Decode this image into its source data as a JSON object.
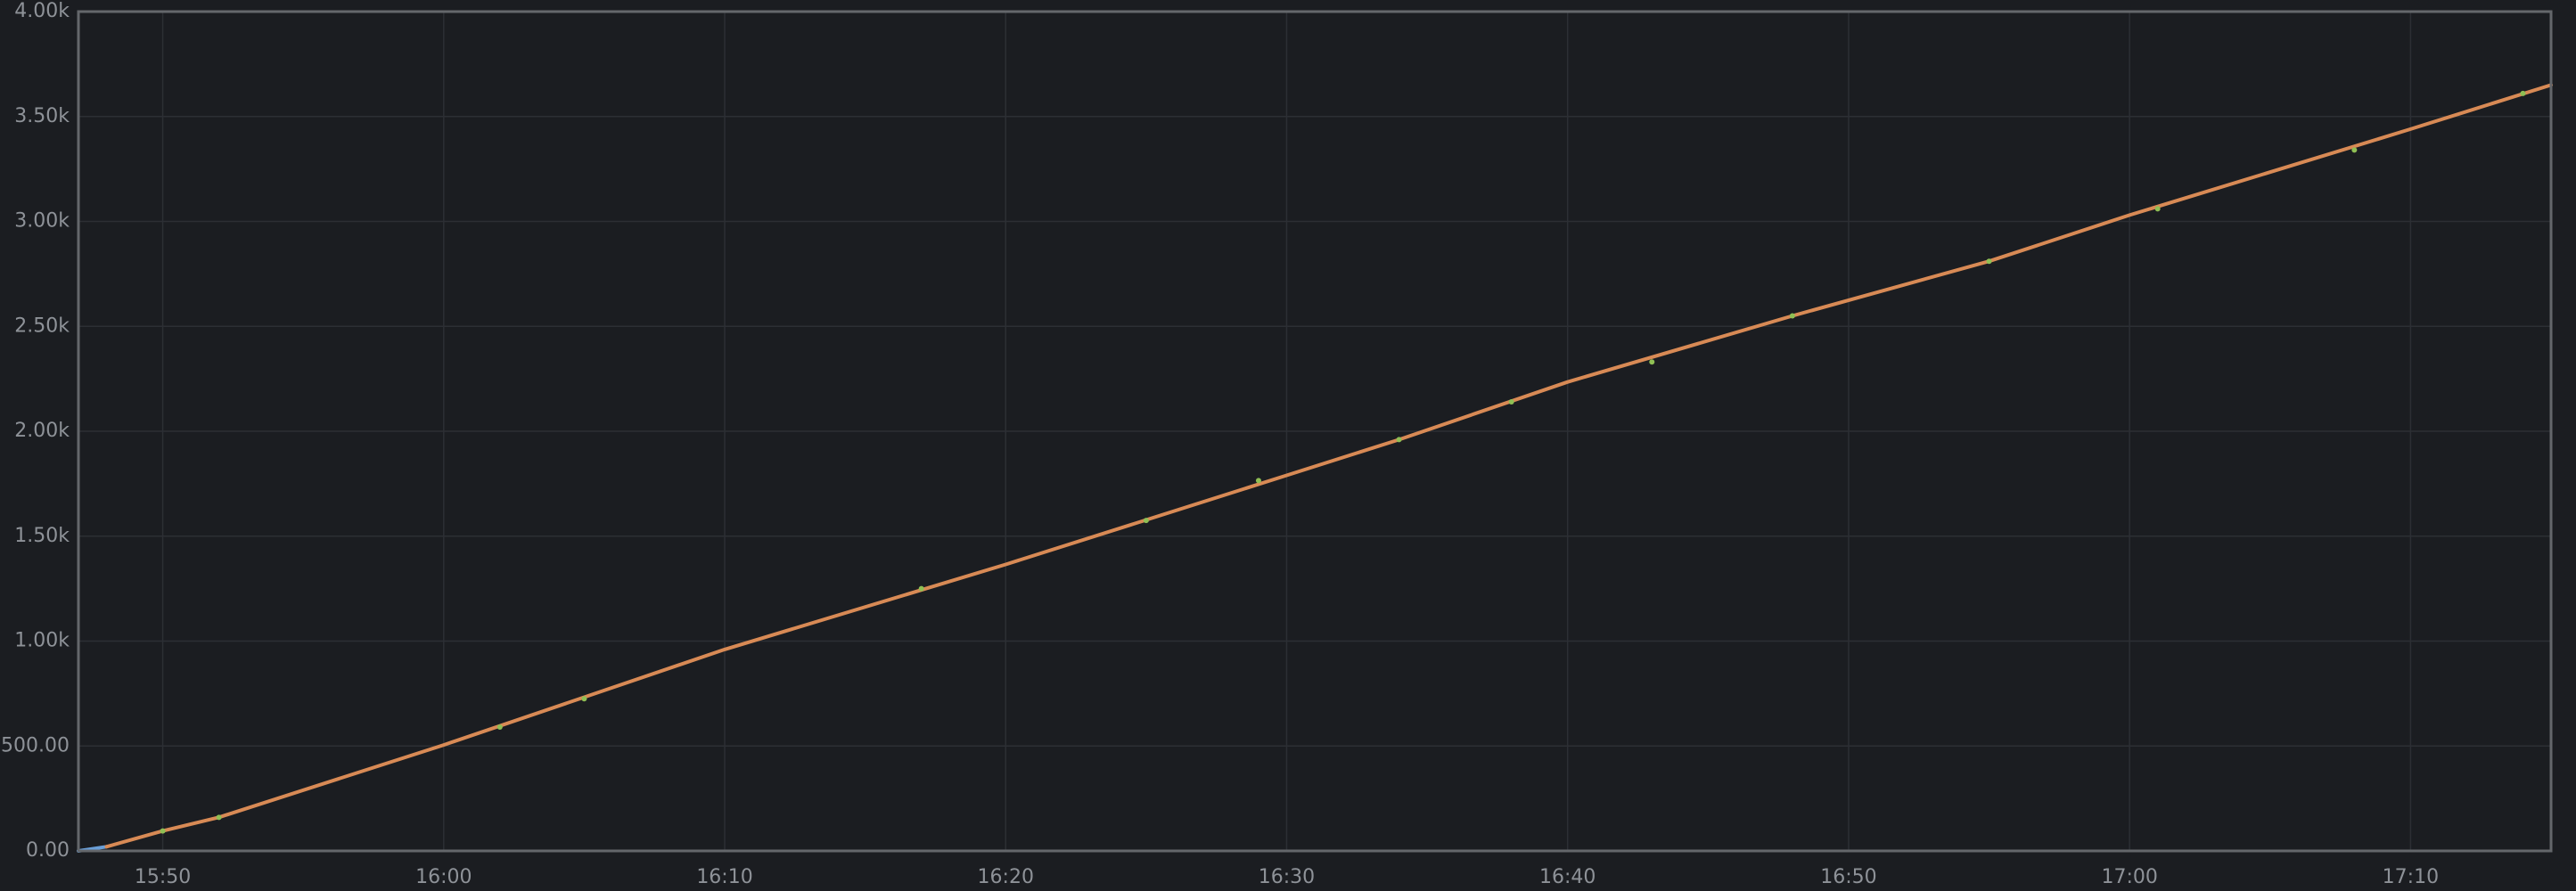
{
  "chart_data": {
    "type": "line",
    "title": "",
    "xlabel": "",
    "ylabel": "",
    "x_ticks": [
      "15:50",
      "16:00",
      "16:10",
      "16:20",
      "16:30",
      "16:40",
      "16:50",
      "17:00",
      "17:10"
    ],
    "y_ticks": [
      "0.00",
      "500.00",
      "1.00k",
      "1.50k",
      "2.00k",
      "2.50k",
      "3.00k",
      "3.50k",
      "4.00k"
    ],
    "xlim": [
      "15:47",
      "17:15"
    ],
    "ylim": [
      0,
      4000
    ],
    "grid": true,
    "legend": "none",
    "series": [
      {
        "color": "#6a9fd8",
        "x": [
          "15:47",
          "15:48"
        ],
        "y": [
          0,
          20
        ]
      },
      {
        "color": "#d88a55",
        "x": [
          "15:48",
          "15:50",
          "15:52",
          "16:00",
          "16:10",
          "16:20",
          "16:30",
          "16:34",
          "16:40",
          "16:48",
          "16:55",
          "17:00",
          "17:10",
          "17:15"
        ],
        "y": [
          20,
          95,
          160,
          505,
          960,
          1365,
          1790,
          1960,
          2235,
          2550,
          2810,
          3030,
          3440,
          3650
        ]
      }
    ],
    "markers": {
      "color": "#8fbf54",
      "x": [
        "15:50",
        "15:52",
        "16:02",
        "16:05",
        "16:17",
        "16:25",
        "16:29",
        "16:34",
        "16:38",
        "16:43",
        "16:48",
        "16:55",
        "17:01",
        "17:08",
        "17:14"
      ],
      "y": [
        95,
        160,
        590,
        725,
        1250,
        1575,
        1765,
        1960,
        2140,
        2330,
        2550,
        2810,
        3060,
        3340,
        3610
      ]
    }
  }
}
